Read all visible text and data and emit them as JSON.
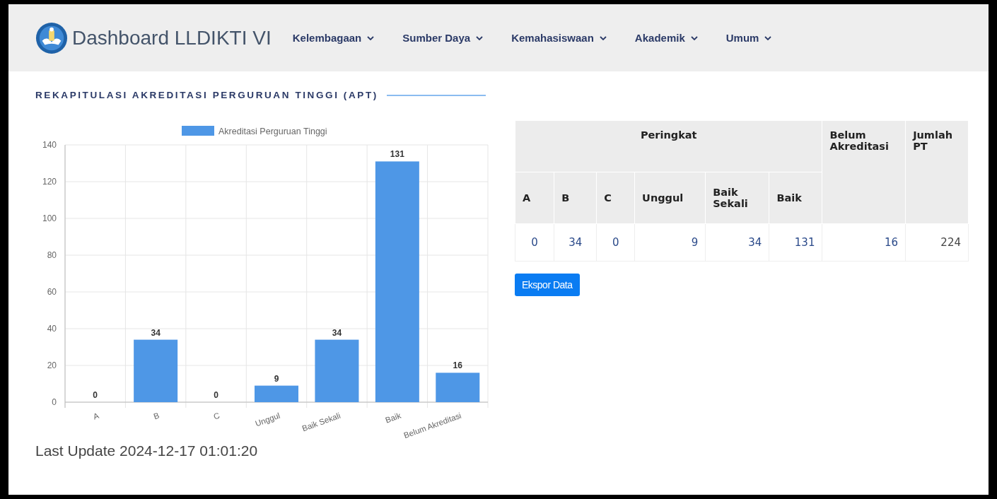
{
  "header": {
    "title": "Dashboard LLDIKTI VI",
    "nav": [
      {
        "label": "Kelembagaan"
      },
      {
        "label": "Sumber Daya"
      },
      {
        "label": "Kemahasiswaan"
      },
      {
        "label": "Akademik"
      },
      {
        "label": "Umum"
      }
    ]
  },
  "section_title": "REKAPITULASI AKREDITASI PERGURUAN TINGGI (APT)",
  "chart_data": {
    "type": "bar",
    "categories": [
      "A",
      "B",
      "C",
      "Unggul",
      "Baik Sekali",
      "Baik",
      "Belum Akreditasi"
    ],
    "series": [
      {
        "name": "Akreditasi Perguruan Tinggi",
        "color": "#4e97e6",
        "values": [
          0,
          34,
          0,
          9,
          34,
          131,
          16
        ]
      }
    ],
    "ylim": [
      0,
      140
    ],
    "yticks": [
      0,
      20,
      40,
      60,
      80,
      100,
      120,
      140
    ],
    "data_labels": true,
    "grid": true
  },
  "last_update": "Last Update 2024-12-17 01:01:20",
  "table": {
    "group_header": "Peringkat",
    "columns": [
      "A",
      "B",
      "C",
      "Unggul",
      "Baik Sekali",
      "Baik"
    ],
    "extra_columns": [
      "Belum Akreditasi",
      "Jumlah PT"
    ],
    "rows": [
      [
        "0",
        "34",
        "0",
        "9",
        "34",
        "131",
        "16",
        "224"
      ]
    ]
  },
  "export_button": "Ekspor Data"
}
